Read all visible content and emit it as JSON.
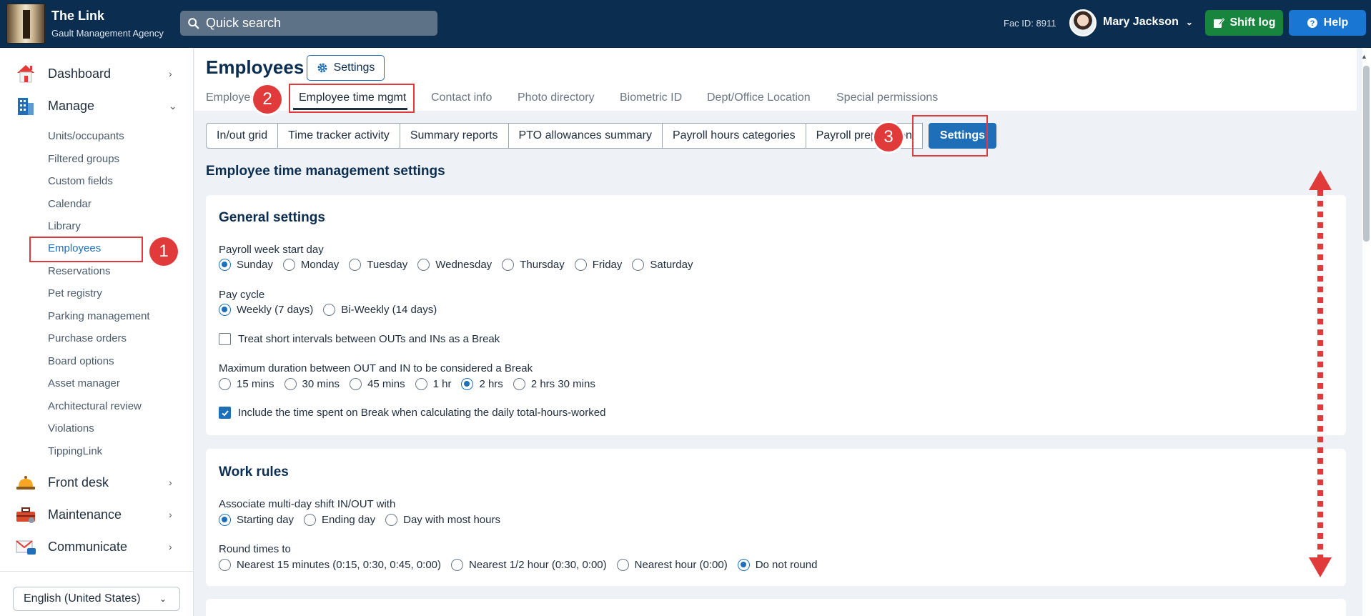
{
  "header": {
    "brand_name": "The Link",
    "brand_sub": "Gault Management Agency",
    "search_placeholder": "Quick search",
    "fac_id": "Fac ID: 8911",
    "user_name": "Mary Jackson",
    "shift_log": "Shift log",
    "help": "Help"
  },
  "sidebar": {
    "dashboard": "Dashboard",
    "manage": "Manage",
    "items": [
      "Units/occupants",
      "Filtered groups",
      "Custom fields",
      "Calendar",
      "Library",
      "Employees",
      "Reservations",
      "Pet registry",
      "Parking management",
      "Purchase orders",
      "Board options",
      "Asset manager",
      "Architectural review",
      "Violations",
      "TippingLink"
    ],
    "front_desk": "Front desk",
    "maintenance": "Maintenance",
    "communicate": "Communicate",
    "language": "English (United States)"
  },
  "page": {
    "title": "Employees",
    "settings_button": "Settings",
    "tabs": [
      "Employees",
      "Employee time mgmt",
      "Contact info",
      "Photo directory",
      "Biometric ID",
      "Dept/Office Location",
      "Special permissions"
    ],
    "subtabs": [
      "In/out grid",
      "Time tracker activity",
      "Summary reports",
      "PTO allowances summary",
      "Payroll hours categories",
      "Payroll preparation",
      "Settings"
    ],
    "section_title": "Employee time management settings"
  },
  "general": {
    "title": "General settings",
    "week_start_label": "Payroll week start day",
    "week_days": [
      "Sunday",
      "Monday",
      "Tuesday",
      "Wednesday",
      "Thursday",
      "Friday",
      "Saturday"
    ],
    "pay_cycle_label": "Pay cycle",
    "pay_cycles": [
      "Weekly (7 days)",
      "Bi-Weekly (14 days)"
    ],
    "treat_short_label": "Treat short intervals between OUTs and INs as a Break",
    "max_duration_label": "Maximum duration between OUT and IN to be considered a Break",
    "durations": [
      "15 mins",
      "30 mins",
      "45 mins",
      "1 hr",
      "2 hrs",
      "2 hrs 30 mins"
    ],
    "include_break_label": "Include the time spent on Break when calculating the daily total-hours-worked"
  },
  "work_rules": {
    "title": "Work rules",
    "assoc_label": "Associate multi-day shift IN/OUT with",
    "assoc_options": [
      "Starting day",
      "Ending day",
      "Day with most hours"
    ],
    "round_label": "Round times to",
    "round_options": [
      "Nearest 15 minutes (0:15, 0:30, 0:45, 0:00)",
      "Nearest 1/2 hour (0:30, 0:00)",
      "Nearest hour (0:00)",
      "Do not round"
    ]
  },
  "annotations": {
    "step1": "1",
    "step2": "2",
    "step3": "3"
  },
  "colors": {
    "header_bg": "#0b2d4f",
    "accent": "#1f6fb8",
    "highlight": "#e03a3a",
    "shift_log_green": "#17853e"
  }
}
